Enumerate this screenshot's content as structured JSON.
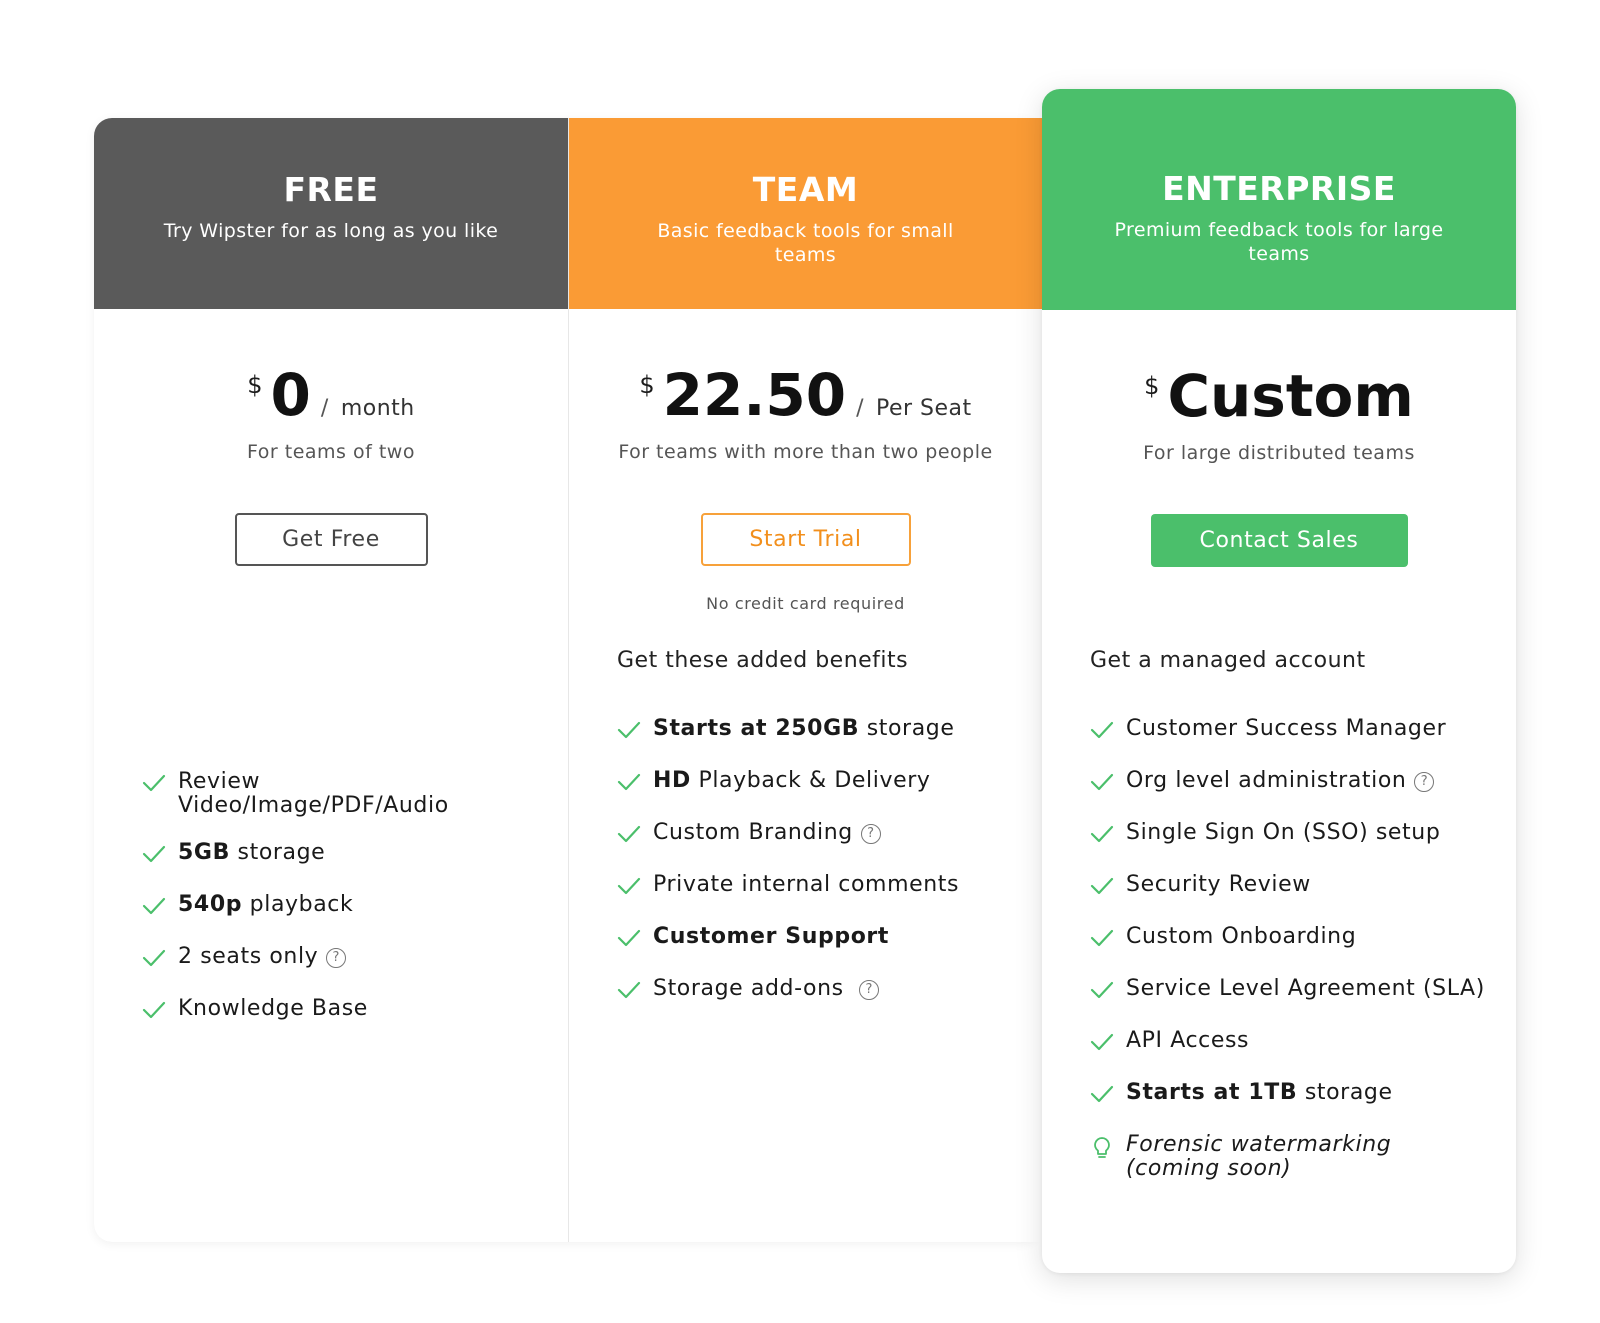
{
  "colors": {
    "free_header": "#5a5a5a",
    "team_header": "#fa9b35",
    "enterprise_header": "#4bbf6b",
    "check": "#4bbf6b",
    "team_button_border": "#f7a13a",
    "enterprise_button": "#4bbf6b"
  },
  "plans": {
    "free": {
      "tier": "FREE",
      "tagline": "Try Wipster for as long as you like",
      "currency": "$",
      "amount": "0",
      "slash": "/",
      "period": "month",
      "subtext": "For teams of two",
      "button": "Get Free",
      "features": [
        {
          "pre": "",
          "bold": "",
          "text": "Review Video/Image/PDF/Audio",
          "help": false,
          "icon": "check-icon"
        },
        {
          "pre": "",
          "bold": "5GB",
          "text": " storage",
          "help": false,
          "icon": "check-icon"
        },
        {
          "pre": "",
          "bold": "540p",
          "text": " playback",
          "help": false,
          "icon": "check-icon"
        },
        {
          "pre": "",
          "bold": "",
          "text": "2 seats only",
          "help": true,
          "icon": "check-icon"
        },
        {
          "pre": "",
          "bold": "",
          "text": "Knowledge Base",
          "help": false,
          "icon": "check-icon"
        }
      ]
    },
    "team": {
      "tier": "TEAM",
      "tagline": "Basic feedback tools for small teams",
      "currency": "$",
      "amount": "22.50",
      "slash": "/",
      "period": "Per Seat",
      "subtext": "For teams with more than two people",
      "button": "Start Trial",
      "note": "No credit card required",
      "intro": "Get these added benefits",
      "features": [
        {
          "pre": "",
          "bold": "Starts at 250GB",
          "text": " storage",
          "help": false,
          "icon": "check-icon"
        },
        {
          "pre": "",
          "bold": "HD",
          "text": " Playback & Delivery",
          "help": false,
          "icon": "check-icon"
        },
        {
          "pre": "",
          "bold": "",
          "text": "Custom Branding",
          "help": true,
          "icon": "check-icon"
        },
        {
          "pre": "",
          "bold": "",
          "text": "Private internal comments",
          "help": false,
          "icon": "check-icon"
        },
        {
          "pre": "",
          "bold": "Customer Support",
          "text": "",
          "help": false,
          "icon": "check-icon"
        },
        {
          "pre": "",
          "bold": "",
          "text": "Storage add-ons ",
          "help": true,
          "icon": "check-icon"
        }
      ]
    },
    "enterprise": {
      "tier": "ENTERPRISE",
      "tagline": "Premium feedback tools for large teams",
      "currency": "$",
      "amount": "Custom",
      "subtext": "For large distributed teams",
      "button": "Contact Sales",
      "intro": "Get a managed account",
      "features": [
        {
          "pre": "",
          "bold": "",
          "text": "Customer Success Manager",
          "help": false,
          "icon": "check-icon"
        },
        {
          "pre": "",
          "bold": "",
          "text": "Org level administration",
          "help": true,
          "icon": "check-icon"
        },
        {
          "pre": "",
          "bold": "",
          "text": "Single Sign On (SSO) setup",
          "help": false,
          "icon": "check-icon"
        },
        {
          "pre": "",
          "bold": "",
          "text": "Security Review",
          "help": false,
          "icon": "check-icon"
        },
        {
          "pre": "",
          "bold": "",
          "text": "Custom Onboarding",
          "help": false,
          "icon": "check-icon"
        },
        {
          "pre": "",
          "bold": "",
          "text": "Service Level Agreement (SLA)",
          "help": false,
          "icon": "check-icon"
        },
        {
          "pre": "",
          "bold": "",
          "text": "API Access",
          "help": false,
          "icon": "check-icon"
        },
        {
          "pre": "",
          "bold": "Starts at 1TB",
          "text": " storage",
          "help": false,
          "icon": "check-icon"
        },
        {
          "pre": "",
          "bold": "",
          "text": "Forensic watermarking (coming soon)",
          "help": false,
          "italic": true,
          "icon": "lightbulb-icon"
        }
      ]
    }
  },
  "help_glyph": "?"
}
